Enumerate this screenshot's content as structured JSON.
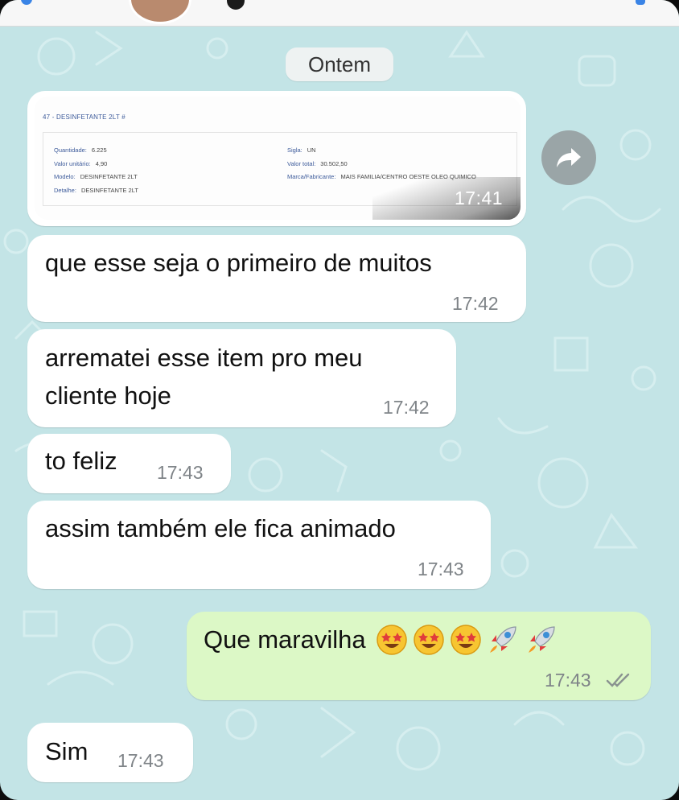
{
  "date_divider": "Ontem",
  "image_message": {
    "time": "17:41",
    "document": {
      "title": "47 - DESINFETANTE 2LT #",
      "left_fields": [
        {
          "label": "Quantidade:",
          "value": "6.225"
        },
        {
          "label": "Valor unitário:",
          "value": "4,90"
        },
        {
          "label": "Modelo:",
          "value": "DESINFETANTE 2LT"
        },
        {
          "label": "Detalhe:",
          "value": "DESINFETANTE 2LT"
        }
      ],
      "right_fields": [
        {
          "label": "Sigla:",
          "value": "UN"
        },
        {
          "label": "Valor total:",
          "value": "30.502,50"
        },
        {
          "label": "Marca/Fabricante:",
          "value": "MAIS FAMILIA/CENTRO OESTE OLEO QUIMICO"
        }
      ]
    }
  },
  "messages": [
    {
      "direction": "in",
      "lines": [
        "que esse seja o primeiro de muitos"
      ],
      "time": "17:42"
    },
    {
      "direction": "in",
      "lines": [
        "arrematei esse item pro meu",
        "cliente hoje"
      ],
      "time": "17:42"
    },
    {
      "direction": "in",
      "lines": [
        "to feliz"
      ],
      "time": "17:43"
    },
    {
      "direction": "in",
      "lines": [
        "assim também ele fica animado"
      ],
      "time": "17:43"
    },
    {
      "direction": "out",
      "lines": [
        "Que maravilha"
      ],
      "emojis": [
        "star-struck-emoji",
        "star-struck-emoji",
        "star-struck-emoji",
        "rocket-emoji",
        "rocket-emoji"
      ],
      "time": "17:43",
      "status": "read"
    },
    {
      "direction": "in",
      "lines": [
        "Sim"
      ],
      "time": "17:43"
    }
  ],
  "icons": {
    "forward": "forward-share-icon",
    "read_receipt": "double-check-icon"
  },
  "colors": {
    "chat_background": "#c3e4e6",
    "incoming_bubble": "#ffffff",
    "outgoing_bubble": "#dcf8c6",
    "timestamp": "#7f8488",
    "forward_button": "#9aa5a7"
  }
}
